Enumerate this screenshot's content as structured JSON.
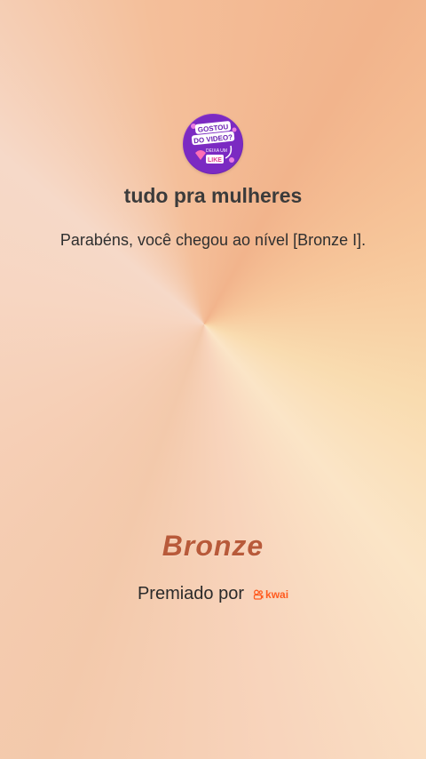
{
  "profile": {
    "avatar_icon": "gostou-do-video-icon",
    "avatar_lettering": [
      "GOSTOU",
      "DO VIDEO?",
      "DEIXA UM",
      "LIKE"
    ],
    "username": "tudo pra mulheres"
  },
  "message": "Parabéns, você chegou ao nível [Bronze I].",
  "rank": {
    "label": "Bronze",
    "color": "#b85a3a"
  },
  "awarded": {
    "label": "Premiado por",
    "brand": "kwai",
    "brand_color": "#ff5b1f"
  }
}
